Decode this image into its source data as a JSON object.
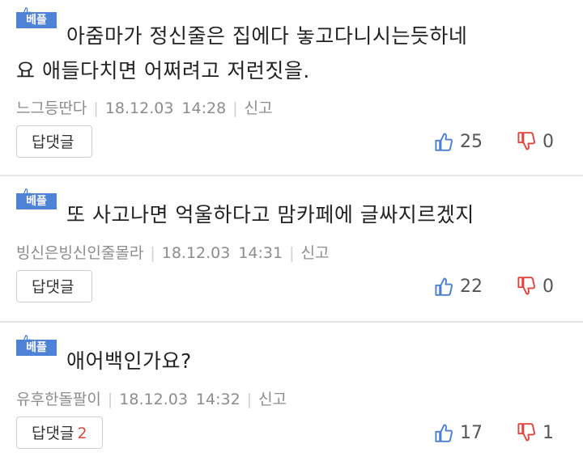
{
  "badge_label": "베플",
  "reply_label": "답댓글",
  "report_label": "신고",
  "colors": {
    "badge": "#4d82d6",
    "up": "#4a7fd3",
    "down": "#e0463f"
  },
  "comments": [
    {
      "text_line1": "아줌마가 정신줄은 집에다 놓고다니시는듯하네",
      "text_line2": "요 애들다치면 어쩌려고 저런짓을.",
      "author": "느그등딴다",
      "date": "18.12.03",
      "time": "14:28",
      "reply_count": "",
      "up": "25",
      "down": "0"
    },
    {
      "text_line1": "또 사고나면 억울하다고 맘카페에 글싸지르겠지",
      "author": "빙신은빙신인줄몰라",
      "date": "18.12.03",
      "time": "14:31",
      "reply_count": "",
      "up": "22",
      "down": "0"
    },
    {
      "text_line1": "애어백인가요?",
      "author": "유후한돌팔이",
      "date": "18.12.03",
      "time": "14:32",
      "reply_count": "2",
      "up": "17",
      "down": "1"
    }
  ]
}
